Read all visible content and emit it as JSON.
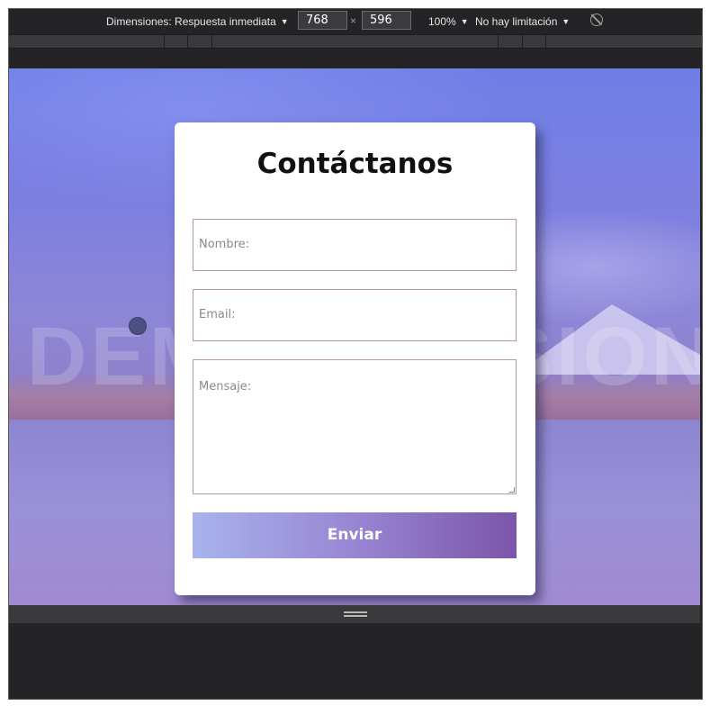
{
  "toolbar": {
    "dimensions_label": "Dimensiones: Respuesta inmediata",
    "width_value": "768",
    "times": "×",
    "height_value": "596",
    "zoom": "100%",
    "throttling": "No hay limitación",
    "caret": "▼"
  },
  "viewport": {
    "watermark": "DEMO VERSION"
  },
  "contact_form": {
    "title": "Contáctanos",
    "name_placeholder": "Nombre:",
    "email_placeholder": "Email:",
    "message_placeholder": "Mensaje:",
    "submit_label": "Enviar"
  },
  "colors": {
    "toolbar_bg": "#242427",
    "button_gradient_start": "#a8b3ec",
    "button_gradient_end": "#7c55ab",
    "field_border": "#b59aa4"
  }
}
